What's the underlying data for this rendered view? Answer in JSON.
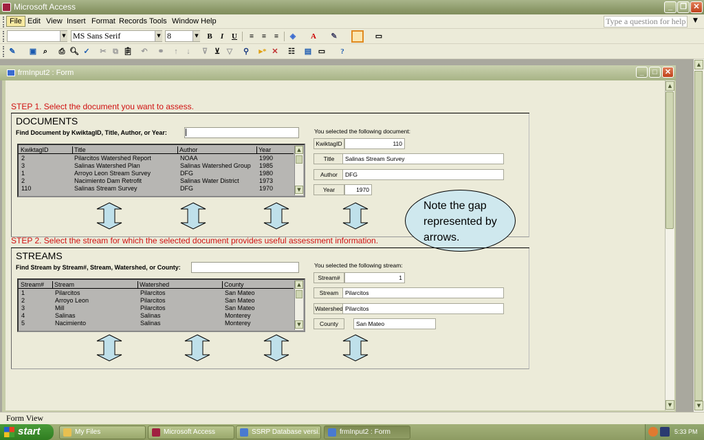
{
  "app": {
    "title": "Microsoft Access"
  },
  "menu": [
    "File",
    "Edit",
    "View",
    "Insert",
    "Format",
    "Records",
    "Tools",
    "Window",
    "Help"
  ],
  "help_placeholder": "Type a question for help",
  "toolbar": {
    "font_name": "MS Sans Serif",
    "font_size": "8",
    "bold": "B",
    "italic": "I",
    "underline": "U"
  },
  "child_title": "frmInput2 : Form",
  "step1": "STEP 1. Select the document you want to assess.",
  "documents": {
    "heading": "DOCUMENTS",
    "find_label": "Find Document by KwiktagID, Title, Author, or Year:",
    "find_value": "",
    "columns": [
      "KwiktagID",
      "Title",
      "Author",
      "Year"
    ],
    "rows": [
      [
        "2",
        "Pilarcitos Watershed Report",
        "NOAA",
        "1990"
      ],
      [
        "3",
        "Salinas Watershed Plan",
        "Salinas Watershed Group",
        "1985"
      ],
      [
        "1",
        "Arroyo Leon Stream Survey",
        "DFG",
        "1980"
      ],
      [
        "2",
        "Nacimiento Dam Retrofit",
        "Salinas Water District",
        "1973"
      ],
      [
        "110",
        "Salinas Stream Survey",
        "DFG",
        "1970"
      ]
    ],
    "selected_label": "You selected the following document:",
    "fields": [
      {
        "label": "KwiktagID",
        "value": "110"
      },
      {
        "label": "Title",
        "value": "Salinas Stream Survey"
      },
      {
        "label": "Author",
        "value": "DFG"
      },
      {
        "label": "Year",
        "value": "1970"
      }
    ]
  },
  "callout": "Note the gap represented by arrows.",
  "step2": "STEP 2. Select the stream for which the selected document provides useful assessment information.",
  "streams": {
    "heading": "STREAMS",
    "find_label": "Find Stream by Stream#, Stream, Watershed, or County:",
    "find_value": "",
    "columns": [
      "Stream#",
      "Stream",
      "Watershed",
      "County"
    ],
    "rows": [
      [
        "1",
        "Pilarcitos",
        "Pilarcitos",
        "San Mateo"
      ],
      [
        "2",
        "Arroyo Leon",
        "Pilarcitos",
        "San Mateo"
      ],
      [
        "3",
        "Mill",
        "Pilarcitos",
        "San Mateo"
      ],
      [
        "4",
        "Salinas",
        "Salinas",
        "Monterey"
      ],
      [
        "5",
        "Nacimiento",
        "Salinas",
        "Monterey"
      ]
    ],
    "selected_label": "You selected the following stream:",
    "fields": [
      {
        "label": "Stream#",
        "value": "1"
      },
      {
        "label": "Stream",
        "value": "Pilarcitos"
      },
      {
        "label": "Watershed",
        "value": "Pilarcitos"
      },
      {
        "label": "County",
        "value": "San Mateo"
      }
    ]
  },
  "status_text": "Form View",
  "taskbar": {
    "start": "start",
    "tasks": [
      "My Files",
      "Microsoft Access",
      "SSRP Database versi...",
      "frmInput2 : Form"
    ],
    "clock": "5:33 PM"
  },
  "colors": {
    "step_red": "#d01010",
    "callout_fill": "#cfe8ee",
    "arrow_fill": "#bfe0ea"
  }
}
